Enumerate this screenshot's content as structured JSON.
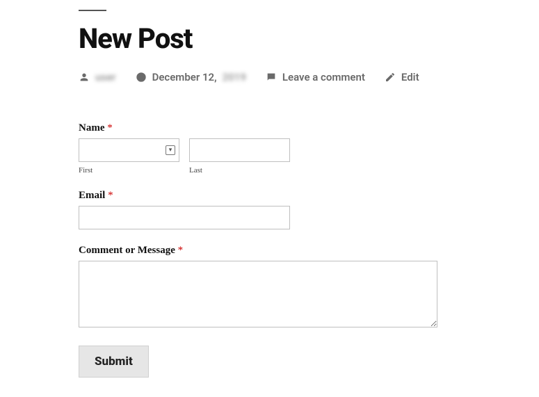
{
  "header": {
    "title": "New Post"
  },
  "meta": {
    "author": "user",
    "date_prefix": "December 12,",
    "date_year": "2019",
    "comment_link": "Leave a comment",
    "edit_link": "Edit"
  },
  "form": {
    "name": {
      "label": "Name",
      "required": "*",
      "first_sub": "First",
      "last_sub": "Last",
      "first_value": "",
      "last_value": ""
    },
    "email": {
      "label": "Email",
      "required": "*",
      "value": ""
    },
    "message": {
      "label": "Comment or Message",
      "required": "*",
      "value": ""
    },
    "submit_label": "Submit"
  },
  "icons": {
    "person": "person-icon",
    "clock": "clock-icon",
    "comment": "comment-icon",
    "pencil": "pencil-icon",
    "autofill": "autofill-contact-icon"
  }
}
